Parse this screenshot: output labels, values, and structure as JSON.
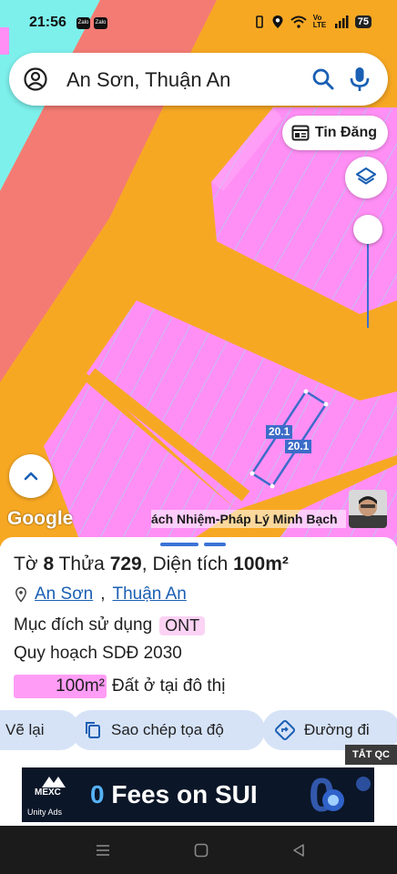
{
  "status_bar": {
    "time": "21:56",
    "apps": [
      "Zalo",
      "Zalo"
    ],
    "network": "Vo LTE",
    "battery": "75"
  },
  "search": {
    "query": "An Sơn, Thuận An"
  },
  "map": {
    "tin_dang_label": "Tin Đăng",
    "plot_labels": [
      "20.1",
      "20.1"
    ],
    "attribution": "Google",
    "ticker_text": "ách Nhiệm-Pháp Lý Minh Bạch",
    "colors": {
      "road": "#f7a823",
      "residential": "#ff8ff5",
      "water": "#7df0ec",
      "river_bank": "#f47b74",
      "selection": "#3c6cc9"
    }
  },
  "parcel": {
    "to_label": "Tờ",
    "to_value": "8",
    "thua_label": "Thửa",
    "thua_value": "729",
    "area_label": "Diện tích",
    "area_value": "100m²",
    "location_commune": "An Sơn",
    "location_district": "Thuận An",
    "purpose_label": "Mục đích sử dụng",
    "purpose_code": "ONT",
    "plan_label": "Quy hoạch SDĐ 2030",
    "plan_area": "100m²",
    "plan_type": "Đất ở tại đô thị"
  },
  "actions": {
    "redraw": "Vẽ lại",
    "copy_coords": "Sao chép tọa độ",
    "directions": "Đường đi"
  },
  "ad": {
    "close_label": "TẮT QC",
    "brand": "MEXC",
    "network": "Unity Ads",
    "headline_num": "0",
    "headline_rest": "Fees on SUI"
  }
}
